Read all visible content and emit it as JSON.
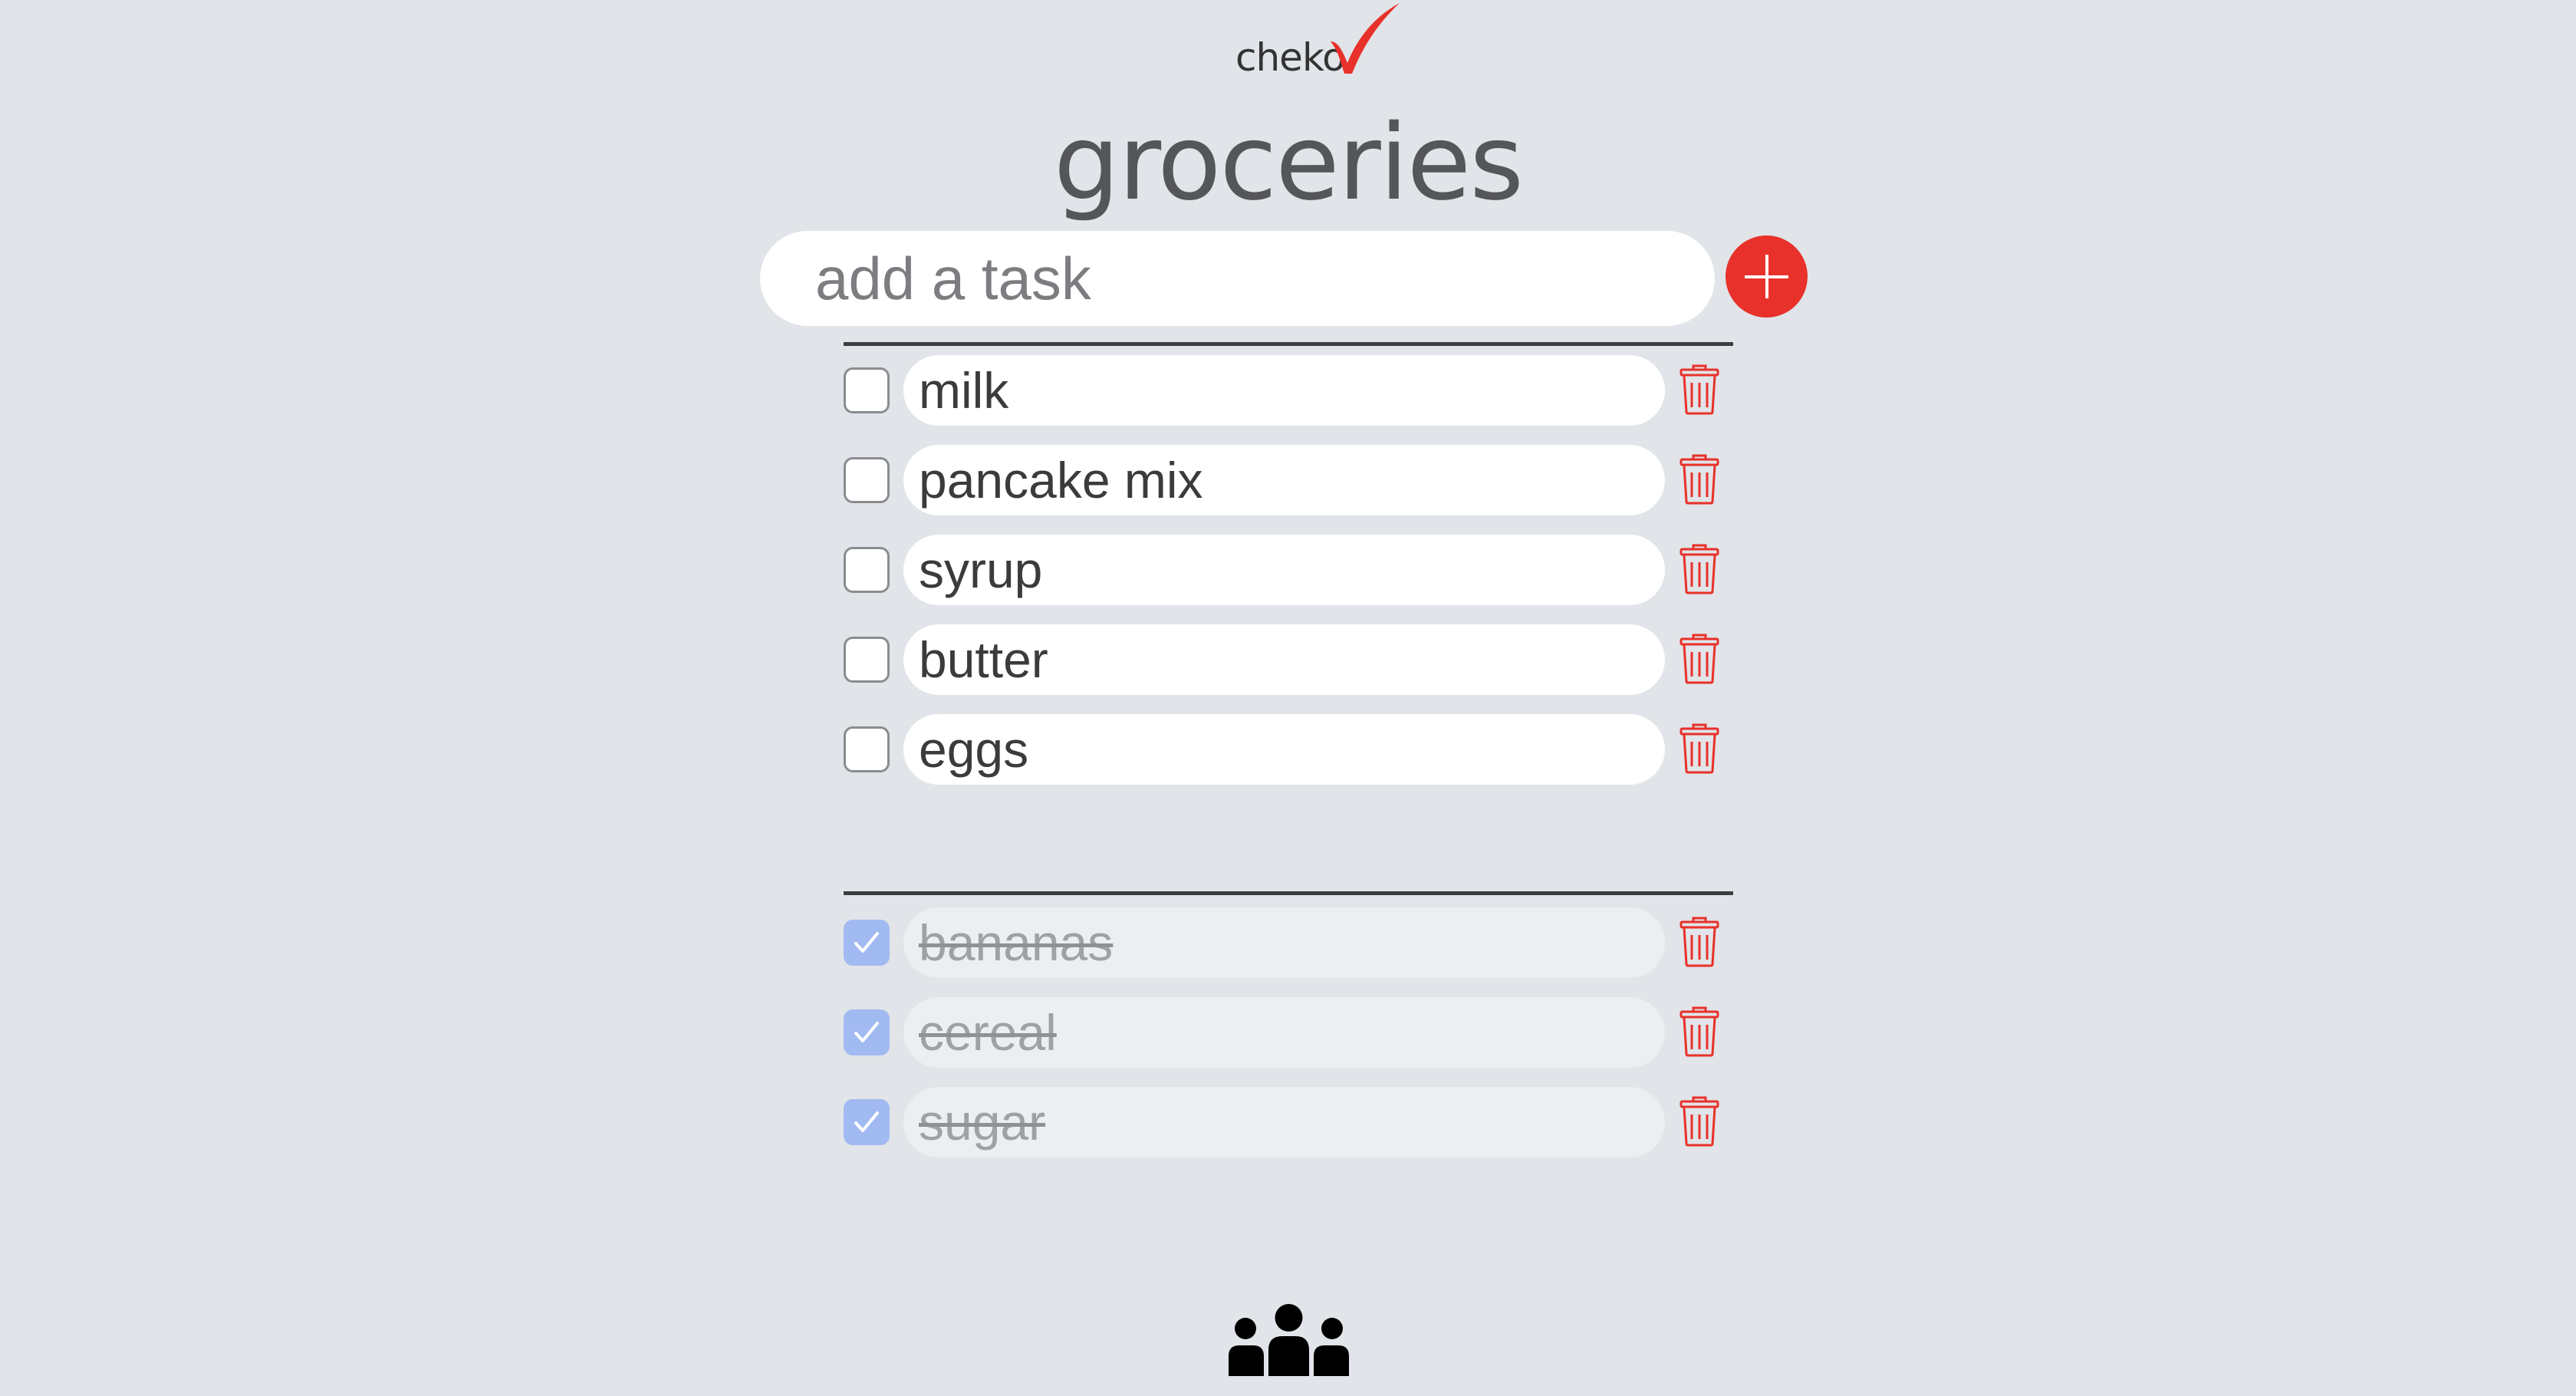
{
  "app": {
    "logo_text": "cheko",
    "brand_color": "#e8312a"
  },
  "list": {
    "title": "groceries"
  },
  "add_task": {
    "placeholder": "add a task",
    "value": "",
    "button_icon": "plus-icon"
  },
  "active_items": [
    {
      "label": "milk",
      "checked": false
    },
    {
      "label": "pancake mix",
      "checked": false
    },
    {
      "label": "syrup",
      "checked": false
    },
    {
      "label": "butter",
      "checked": false
    },
    {
      "label": "eggs",
      "checked": false
    }
  ],
  "completed_items": [
    {
      "label": "bananas",
      "checked": true
    },
    {
      "label": "cereal",
      "checked": true
    },
    {
      "label": "sugar",
      "checked": true
    }
  ],
  "icons": {
    "delete": "trash-icon",
    "checked": "checkmark-icon",
    "collaborators": "people-group-icon"
  },
  "colors": {
    "background": "#e1e4e8",
    "accent": "#e8312a",
    "checked_box": "#a2baf2",
    "divider": "#3b3d40"
  }
}
